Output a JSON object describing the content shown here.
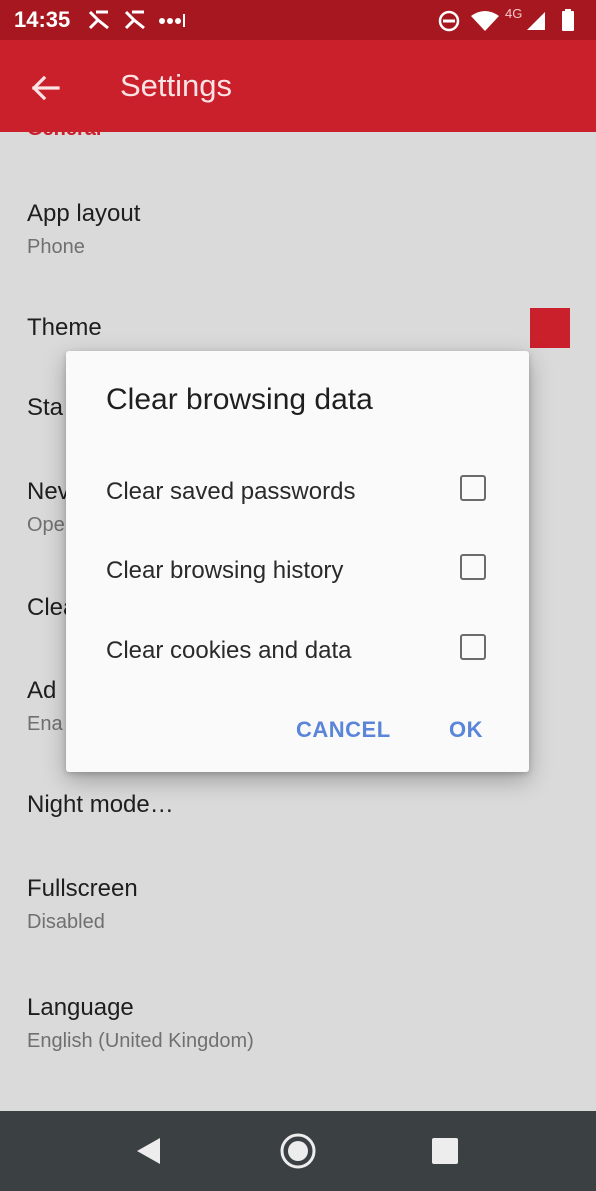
{
  "status_bar": {
    "time": "14:35",
    "network_label": "4G",
    "icons": [
      "notification-app-icon",
      "notification-app-icon",
      "more-notifications-icon",
      "do-not-disturb-icon",
      "wifi-icon",
      "cell-signal-icon",
      "battery-icon"
    ]
  },
  "app_bar": {
    "title": "Settings",
    "back_icon": "arrow-back-icon"
  },
  "settings": {
    "section_header": "General",
    "items": [
      {
        "title": "App layout",
        "subtitle": "Phone"
      },
      {
        "title": "Theme",
        "subtitle": ""
      },
      {
        "title": "Sta",
        "subtitle": ""
      },
      {
        "title": "Nev",
        "subtitle": "Ope"
      },
      {
        "title": "Clea",
        "subtitle": ""
      },
      {
        "title": "Ad",
        "subtitle": "Ena"
      },
      {
        "title": "Night mode…",
        "subtitle": ""
      },
      {
        "title": "Fullscreen",
        "subtitle": "Disabled"
      },
      {
        "title": "Language",
        "subtitle": "English (United Kingdom)"
      }
    ],
    "theme_color": "#c9202c"
  },
  "dialog": {
    "title": "Clear browsing data",
    "options": [
      {
        "label": "Clear saved passwords",
        "checked": false
      },
      {
        "label": "Clear browsing history",
        "checked": false
      },
      {
        "label": "Clear cookies and data",
        "checked": false
      }
    ],
    "cancel_label": "CANCEL",
    "ok_label": "OK"
  },
  "nav_bar": {
    "buttons": [
      "back-triangle-icon",
      "home-circle-icon",
      "recents-square-icon"
    ]
  },
  "colors": {
    "status_bar": "#a7171f",
    "app_bar": "#c9202c",
    "accent_button": "#5a85d8",
    "nav_bar": "#3b4043"
  }
}
